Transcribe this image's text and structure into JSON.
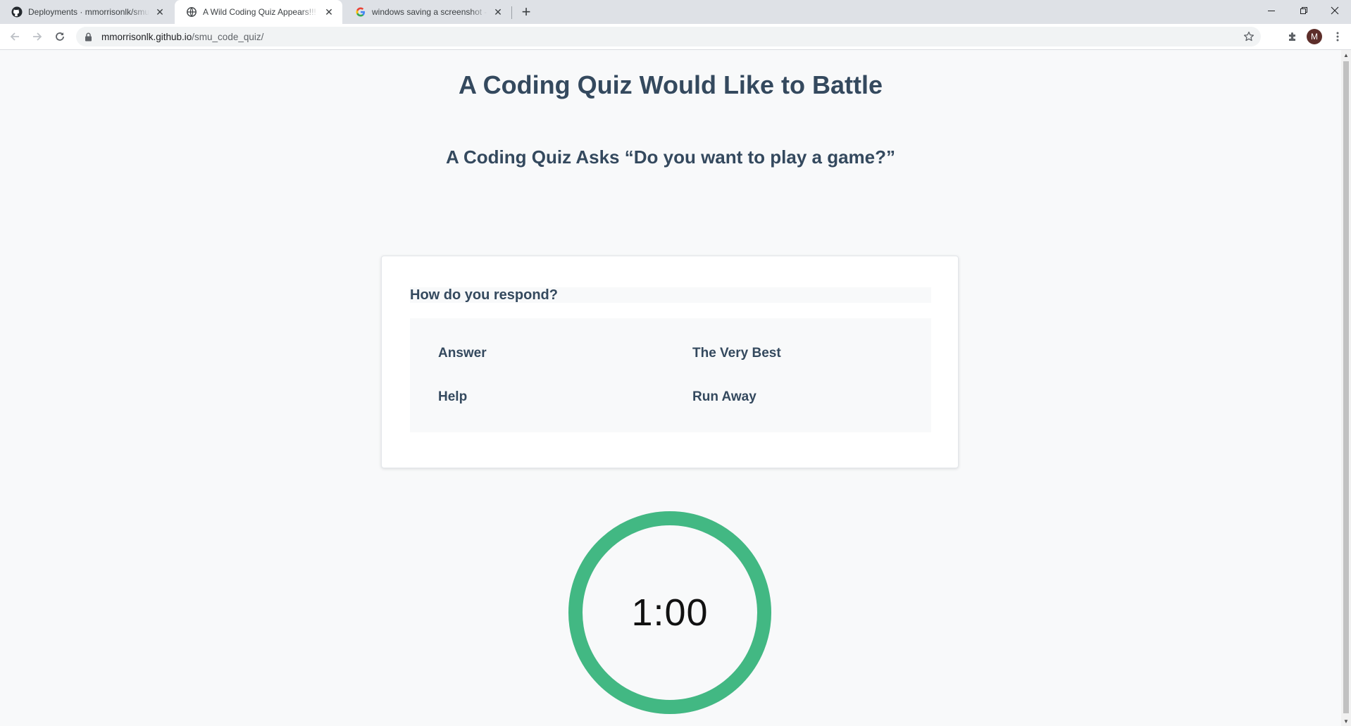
{
  "browser": {
    "tabs": [
      {
        "title": "Deployments · mmorrisonlk/smu_code_quiz",
        "favicon": "github-icon",
        "active": false
      },
      {
        "title": "A Wild Coding Quiz Appears!!!",
        "favicon": "globe-icon",
        "active": true
      },
      {
        "title": "windows saving a screenshot - Google Search",
        "favicon": "google-icon",
        "active": false
      }
    ],
    "new_tab_label": "+",
    "url": {
      "host": "mmorrisonlk.github.io",
      "path": "/smu_code_quiz/"
    },
    "profile_initial": "M",
    "icons": {
      "back": "arrow-left-icon",
      "forward": "arrow-right-icon",
      "reload": "reload-icon",
      "lock": "lock-icon",
      "bookmark": "star-icon",
      "extensions": "puzzle-icon",
      "menu": "kebab-menu-icon",
      "minimize": "minimize-icon",
      "restore": "restore-icon",
      "close": "close-icon"
    }
  },
  "page": {
    "title": "A Coding Quiz Would Like to Battle",
    "subtitle": "A Coding Quiz Asks “Do you want to play a game?”",
    "question": "How do you respond?",
    "options": [
      "Answer",
      "The Very Best",
      "Help",
      "Run Away"
    ],
    "timer": {
      "text": "1:00",
      "ring_color": "#42b883",
      "remaining_fraction": 1.0
    }
  },
  "colors": {
    "heading": "#34495e",
    "background": "#f8f9fa",
    "accent": "#42b883"
  }
}
